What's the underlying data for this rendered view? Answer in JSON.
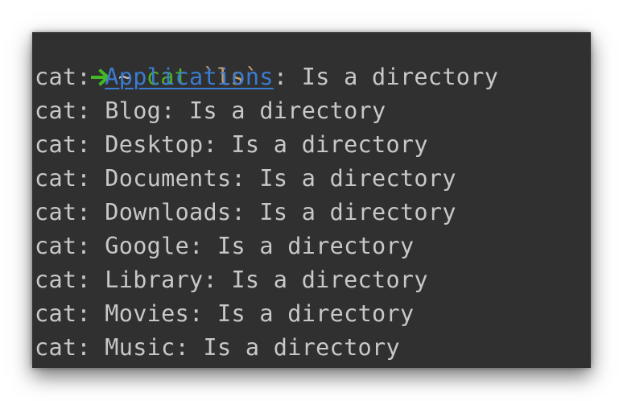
{
  "prompt": {
    "arrow_icon": "right-arrow-icon",
    "cwd": "~",
    "command": "cat",
    "argument": "`ls`",
    "colors": {
      "arrow": "#44b824",
      "command": "#4caf26",
      "argument": "#c9a06a",
      "link": "#3b7bd0",
      "background": "#303030",
      "text": "#c8c8c8"
    }
  },
  "output": [
    {
      "prefix": "cat: ",
      "name": "Applications",
      "suffix": ": Is a directory"
    },
    {
      "prefix": "cat: ",
      "name": "Blog",
      "suffix": ": Is a directory"
    },
    {
      "prefix": "cat: ",
      "name": "Desktop",
      "suffix": ": Is a directory"
    },
    {
      "prefix": "cat: ",
      "name": "Documents",
      "suffix": ": Is a directory"
    },
    {
      "prefix": "cat: ",
      "name": "Downloads",
      "suffix": ": Is a directory"
    },
    {
      "prefix": "cat: ",
      "name": "Google",
      "suffix": ": Is a directory"
    },
    {
      "prefix": "cat: ",
      "name": "Library",
      "suffix": ": Is a directory"
    },
    {
      "prefix": "cat: ",
      "name": "Movies",
      "suffix": ": Is a directory"
    },
    {
      "prefix": "cat: ",
      "name": "Music",
      "suffix": ": Is a directory"
    }
  ]
}
